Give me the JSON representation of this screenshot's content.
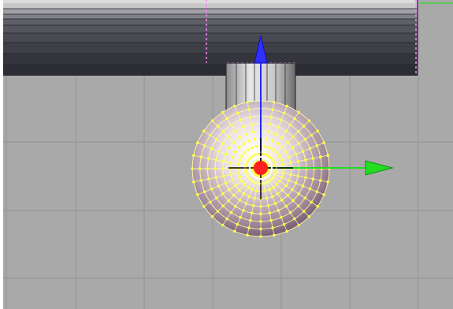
{
  "viewport": {
    "mode": "edit-mode-3d-view",
    "grid": true,
    "colors": {
      "background": "#a9a9a9",
      "grid_line": "#969696",
      "selected_vertex": "#ffff40",
      "selected_edge": "#ffffb0",
      "edge_seam": "#ff80ff",
      "manipulator_z": "#2828ff",
      "manipulator_x": "#22dd22",
      "pivot": "#ff2020"
    }
  },
  "objects": [
    {
      "name": "beam",
      "shading": "gradient-gray",
      "selected": false
    },
    {
      "name": "cylinder",
      "shading": "light-gray",
      "selected": false
    },
    {
      "name": "uv-sphere",
      "shading": "pinkish-purple",
      "selected": true
    }
  ],
  "manipulator": {
    "type": "translate",
    "axes": [
      "z-arrow",
      "x-arrow"
    ],
    "center": "pivot-dot"
  }
}
